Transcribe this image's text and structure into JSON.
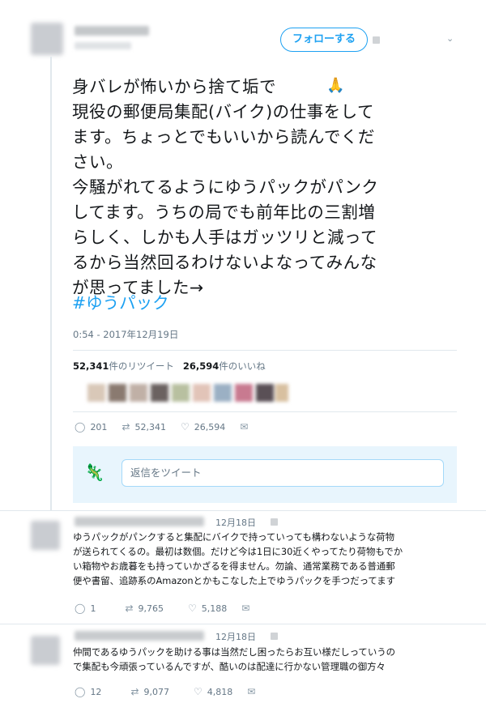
{
  "main_tweet": {
    "follow_label": "フォローする",
    "text": "身バレが怖いから捨て垢で\n現役の郵便局集配(バイク)の仕事をして\nます。ちょっとでもいいから読んでくだ\nさい。\n今騒がれてるようにゆうパックがパンク\nしてます。うちの局でも前年比の三割増\nらしく、しかも人手はガッツリと減って\nるから当然回るわけないよなってみんな\nが思ってました→",
    "emoji": "🙏",
    "hashtag": "#ゆうパック",
    "timestamp": "0:54 - 2017年12月19日",
    "retweet_count": "52,341",
    "retweet_label": "件のリツイート",
    "like_count": "26,594",
    "like_label": "件のいいね",
    "actions": {
      "reply": "201",
      "retweet": "52,341",
      "like": "26,594"
    },
    "reply_placeholder": "返信をツイート"
  },
  "replies": [
    {
      "date": "12月18日",
      "text": "ゆうパックがパンクすると集配にバイクで持っていっても構わないような荷物\nが送られてくるの。最初は数個。だけど今は1日に30近くやってたり荷物もでか\nい箱物やお歳暮をも持っていかざるを得ません。勿論、通常業務である普通郵\n便や書留、追跡系のAmazonとかもこなした上でゆうパックを手つだってます",
      "actions": {
        "reply": "1",
        "retweet": "9,765",
        "like": "5,188"
      }
    },
    {
      "date": "12月18日",
      "text": "仲間であるゆうパックを助ける事は当然だし困ったらお互い様だしっていうの\nで集配も今頑張っているんですが、酷いのは配達に行かない管理職の御方々",
      "actions": {
        "reply": "12",
        "retweet": "9,077",
        "like": "4,818"
      }
    }
  ],
  "icons": [
    "reply-icon",
    "retweet-icon",
    "like-icon",
    "mail-icon",
    "chevron-down-icon",
    "more-icon"
  ],
  "colors": {
    "accent": "#1da1f2",
    "text": "#14171a",
    "muted": "#657786",
    "border": "#e1e8ed"
  }
}
